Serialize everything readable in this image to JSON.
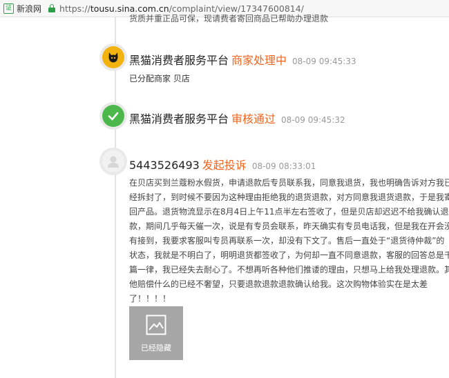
{
  "browser": {
    "site_name": "新浪网",
    "site_icon_glyph": "证",
    "url_scheme": "https://",
    "url_host": "tousu.sina.com.cn",
    "url_path": "/complaint/view/17347600814/"
  },
  "timeline": {
    "top_cut_text": "货质并重正品可保，现请费者寄回商品已帮助办理退款",
    "entries": [
      {
        "avatar": "black-cat-logo",
        "platform": "黑猫消费者服务平台",
        "status": "商家处理中",
        "time": "08-09 09:45:33",
        "detail": "已分配商家 贝店"
      },
      {
        "avatar": "check-icon",
        "platform": "黑猫消费者服务平台",
        "status": "审核通过",
        "time": "08-09 09:45:32"
      }
    ],
    "complaint": {
      "avatar": "user-icon",
      "user": "5443526493",
      "status": "发起投诉",
      "time": "08-09 08:33:01",
      "lines": [
        "在贝店买到兰蔻粉水假货，申请退款后专员联系我，同意我退货，我也明确告诉对方我已",
        "经拆封了，到时候不要因为这种理由拒绝我的退货退款，对方同意我退货退款，于是我寄",
        "回产品。退货物流显示在8月4日上午11点半左右签收了，但是贝店却迟迟不给我确认退",
        "款，期间几乎每天催一次，说是有专员会联系，昨天确实有专员电话我，但是我在开会没",
        "有接到，我要求客服叫专员再联系一次，却没有下文了。售后一直处于“退货待仲裁”的",
        "状态，我就是不明白了，明明退货都签收了，为何却一直不同意退款，客服的回答总是千",
        "篇一律，我已经失去耐心了。不想再听各种他们推诿的理由，只想马上给我处理退款。其",
        "他赔偿什么的已经不奢望，只要退款退款退款确认给我。这次购物体验实在是太差",
        "了！！！！"
      ],
      "image_caption": "已经隐藏"
    }
  },
  "colors": {
    "accent_orange": "#f0641e",
    "cat_yellow": "#f2b20f",
    "check_green": "#4cb84c",
    "lock_green": "#2e9e48",
    "hidden_gray": "#a6a6a6"
  }
}
